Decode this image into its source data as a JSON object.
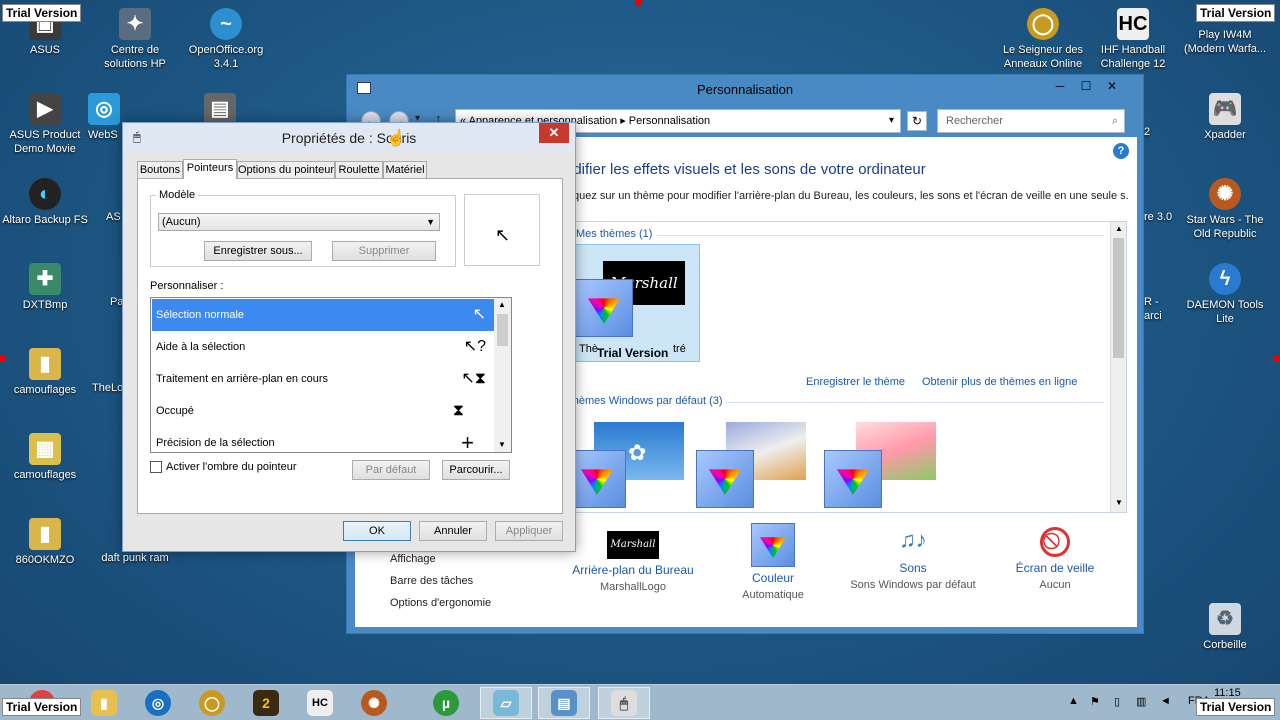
{
  "watermark": "Trial Version",
  "desktop_icons": [
    {
      "label": "ASUS",
      "icon": "asus-icon"
    },
    {
      "label": "Centre de solutions HP",
      "icon": "hp-solution-center-icon"
    },
    {
      "label": "OpenOffice.org 3.4.1",
      "icon": "openoffice-icon"
    },
    {
      "label": "ASUS Product Demo Movie",
      "icon": "movie-icon"
    },
    {
      "label": "WebS",
      "icon": "web-icon"
    },
    {
      "label": "Altaro Backup FS",
      "icon": "backup-icon"
    },
    {
      "label": "AS",
      "icon": "app-icon"
    },
    {
      "label": "DXTBmp",
      "icon": "dxtbmp-icon"
    },
    {
      "label": "Pa",
      "icon": "app-icon"
    },
    {
      "label": "camouflages",
      "icon": "folder-icon"
    },
    {
      "label": "TheLo",
      "icon": "app-icon"
    },
    {
      "label": "camouflages",
      "icon": "archive-icon"
    },
    {
      "label": "860OKMZO",
      "icon": "folder-icon"
    },
    {
      "label": "daft punk ram",
      "icon": "file-icon"
    },
    {
      "label": "Le Seigneur des Anneaux Online",
      "icon": "lotro-icon"
    },
    {
      "label": "IHF Handball Challenge 12",
      "icon": "handball-icon"
    },
    {
      "label": "Play IW4M (Modern Warfa...",
      "icon": "iw4m-icon"
    },
    {
      "label": "Xpadder",
      "icon": "gamepad-icon"
    },
    {
      "label": "Star Wars - The Old Republic",
      "icon": "swtor-icon"
    },
    {
      "label": "DAEMON Tools Lite",
      "icon": "daemon-tools-icon"
    },
    {
      "label": "Corbeille",
      "icon": "recycle-bin-icon"
    },
    {
      "label": "2",
      "icon": "partial-icon"
    },
    {
      "label": "re 3.0",
      "icon": "partial-icon"
    },
    {
      "label": "R - arci",
      "icon": "partial-icon"
    }
  ],
  "perso": {
    "title": "Personnalisation",
    "controls": {
      "minimize": "─",
      "maximize": "☐",
      "close": "✕"
    },
    "breadcrumb": "« Apparence et personnalisation ▸ Personnalisation",
    "search_placeholder": "Rechercher",
    "headline": "odifier les effets visuels et les sons de votre ordinateur",
    "subline": "quez sur un thème pour modifier l'arrière-plan du Bureau, les couleurs, les sons et l'écran de veille en une seule s.",
    "my_themes": "Mes thèmes (1)",
    "theme_caption_left": "Thè",
    "theme_caption_right": "tré",
    "brand": "Marshall",
    "save_theme": "Enregistrer le thème",
    "more_themes": "Obtenir plus de thèmes en ligne",
    "default_themes": "Thèmes Windows par défaut (3)",
    "see_also": [
      "Affichage",
      "Barre des tâches",
      "Options d'ergonomie"
    ],
    "bottom": [
      {
        "label": "Arrière-plan du Bureau",
        "value": "MarshallLogo",
        "icon": "desktop-background-icon"
      },
      {
        "label": "Couleur",
        "value": "Automatique",
        "icon": "color-icon"
      },
      {
        "label": "Sons",
        "value": "Sons Windows par défaut",
        "icon": "sounds-icon"
      },
      {
        "label": "Écran de veille",
        "value": "Aucun",
        "icon": "screensaver-icon"
      }
    ]
  },
  "dialog": {
    "title": "Propriétés de : Souris",
    "tabs": [
      "Boutons",
      "Pointeurs",
      "Options du pointeur",
      "Roulette",
      "Matériel"
    ],
    "active_tab": "Pointeurs",
    "model_label": "Modèle",
    "model_value": "(Aucun)",
    "save_as": "Enregistrer sous...",
    "delete": "Supprimer",
    "customize_label": "Personnaliser :",
    "pointers": [
      {
        "label": "Sélection normale",
        "glyph": "↖"
      },
      {
        "label": "Aide à la sélection",
        "glyph": "↖?"
      },
      {
        "label": "Traitement en arrière-plan en cours",
        "glyph": "↖⧗"
      },
      {
        "label": "Occupé",
        "glyph": "⧗"
      },
      {
        "label": "Précision de la sélection",
        "glyph": "+"
      }
    ],
    "shadow_label": "Activer l'ombre du pointeur",
    "default_btn": "Par défaut",
    "browse_btn": "Parcourir...",
    "ok": "OK",
    "cancel": "Annuler",
    "apply": "Appliquer"
  },
  "taskbar": {
    "lang": "FRA",
    "time": "11:15"
  }
}
